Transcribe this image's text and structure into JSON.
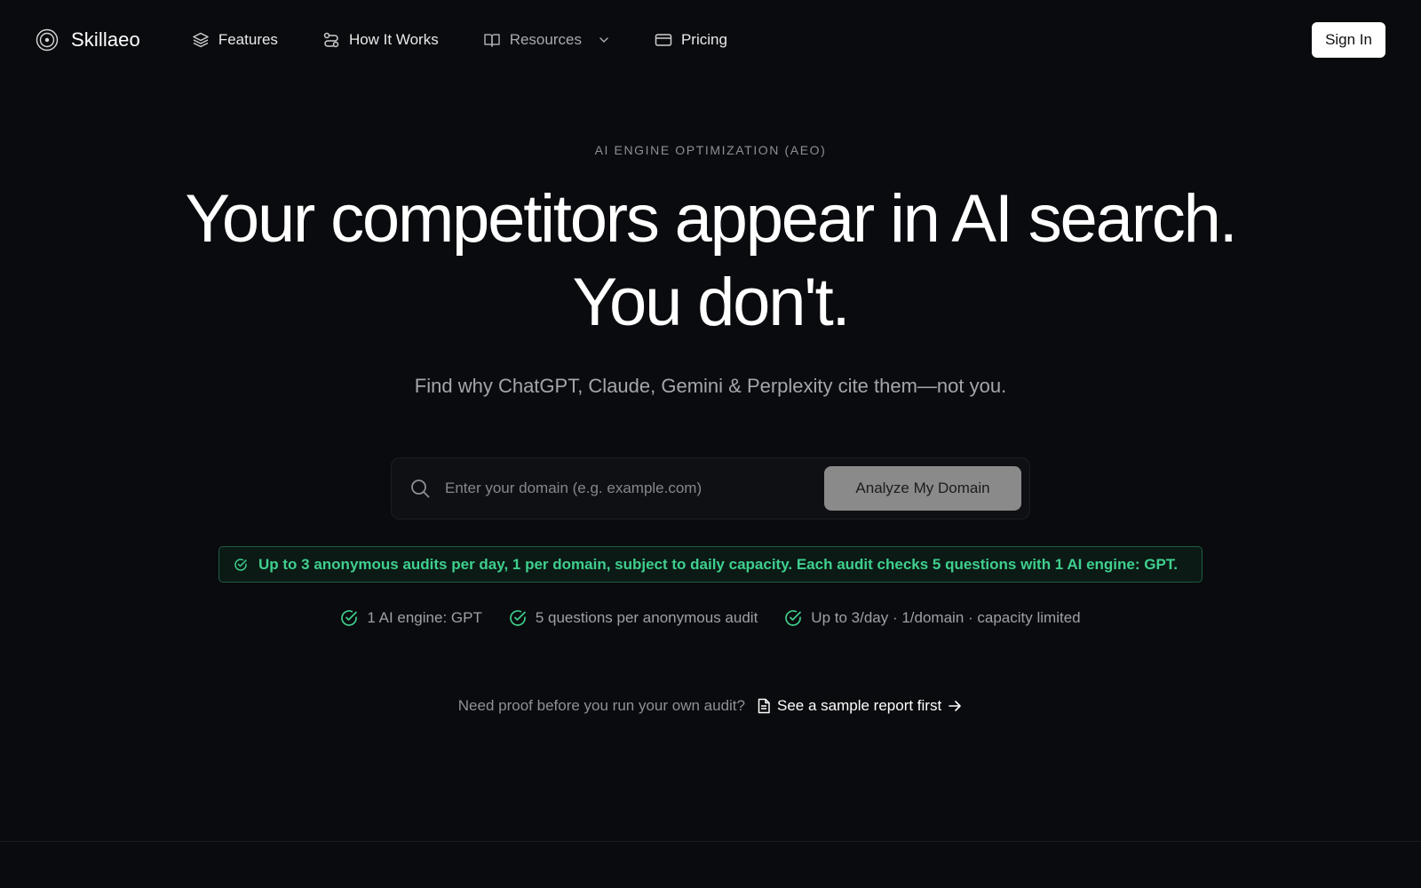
{
  "nav": {
    "brand": "Skillaeo",
    "links": [
      {
        "label": "Features",
        "icon": "layers-icon"
      },
      {
        "label": "How It Works",
        "icon": "workflow-icon"
      },
      {
        "label": "Resources",
        "icon": "book-icon",
        "has_dropdown": true
      },
      {
        "label": "Pricing",
        "icon": "credit-card-icon"
      }
    ],
    "sign_in": "Sign In"
  },
  "hero": {
    "eyebrow": "AI ENGINE OPTIMIZATION (AEO)",
    "headline_line1": "Your competitors appear in AI search.",
    "headline_line2": "You don't.",
    "subhead": "Find why ChatGPT, Claude, Gemini & Perplexity cite them—not you."
  },
  "search": {
    "placeholder": "Enter your domain (e.g. example.com)",
    "value": "",
    "button": "Analyze My Domain"
  },
  "notice": {
    "text": "Up to 3 anonymous audits per day, 1 per domain, subject to daily capacity. Each audit checks 5 questions with 1 AI engine: GPT."
  },
  "features": [
    {
      "label": "1 AI engine: GPT"
    },
    {
      "label": "5 questions per anonymous audit"
    },
    {
      "label": "Up to 3/day · 1/domain · capacity limited"
    }
  ],
  "sample": {
    "prompt": "Need proof before you run your own audit?",
    "link": "See a sample report first"
  },
  "colors": {
    "background": "#0a0b0e",
    "accent_green": "#3fcf8e",
    "button_gray": "#8a8a8a"
  }
}
